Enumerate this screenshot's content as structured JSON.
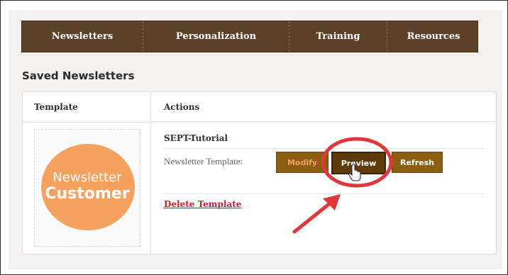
{
  "nav": {
    "items": [
      {
        "label": "Newsletters"
      },
      {
        "label": "Personalization"
      },
      {
        "label": "Training"
      },
      {
        "label": "Resources"
      }
    ]
  },
  "section_title": "Saved Newsletters",
  "table": {
    "headers": {
      "template": "Template",
      "actions": "Actions"
    },
    "row": {
      "thumbnail": {
        "line1": "Newsletter",
        "line2": "Customer"
      },
      "name": "SEPT-Tutorial",
      "template_label": "Newsletter Template:",
      "buttons": {
        "modify": "Modify",
        "preview": "Preview",
        "refresh": "Refresh"
      },
      "delete_label": "Delete Template"
    }
  },
  "colors": {
    "nav_bg": "#5b4128",
    "button_bg": "#8d5e12",
    "preview_bg": "#5e3c0a",
    "logo": "#f6a25f",
    "annotation": "#e0373b",
    "delete_link": "#cc1f2a"
  }
}
